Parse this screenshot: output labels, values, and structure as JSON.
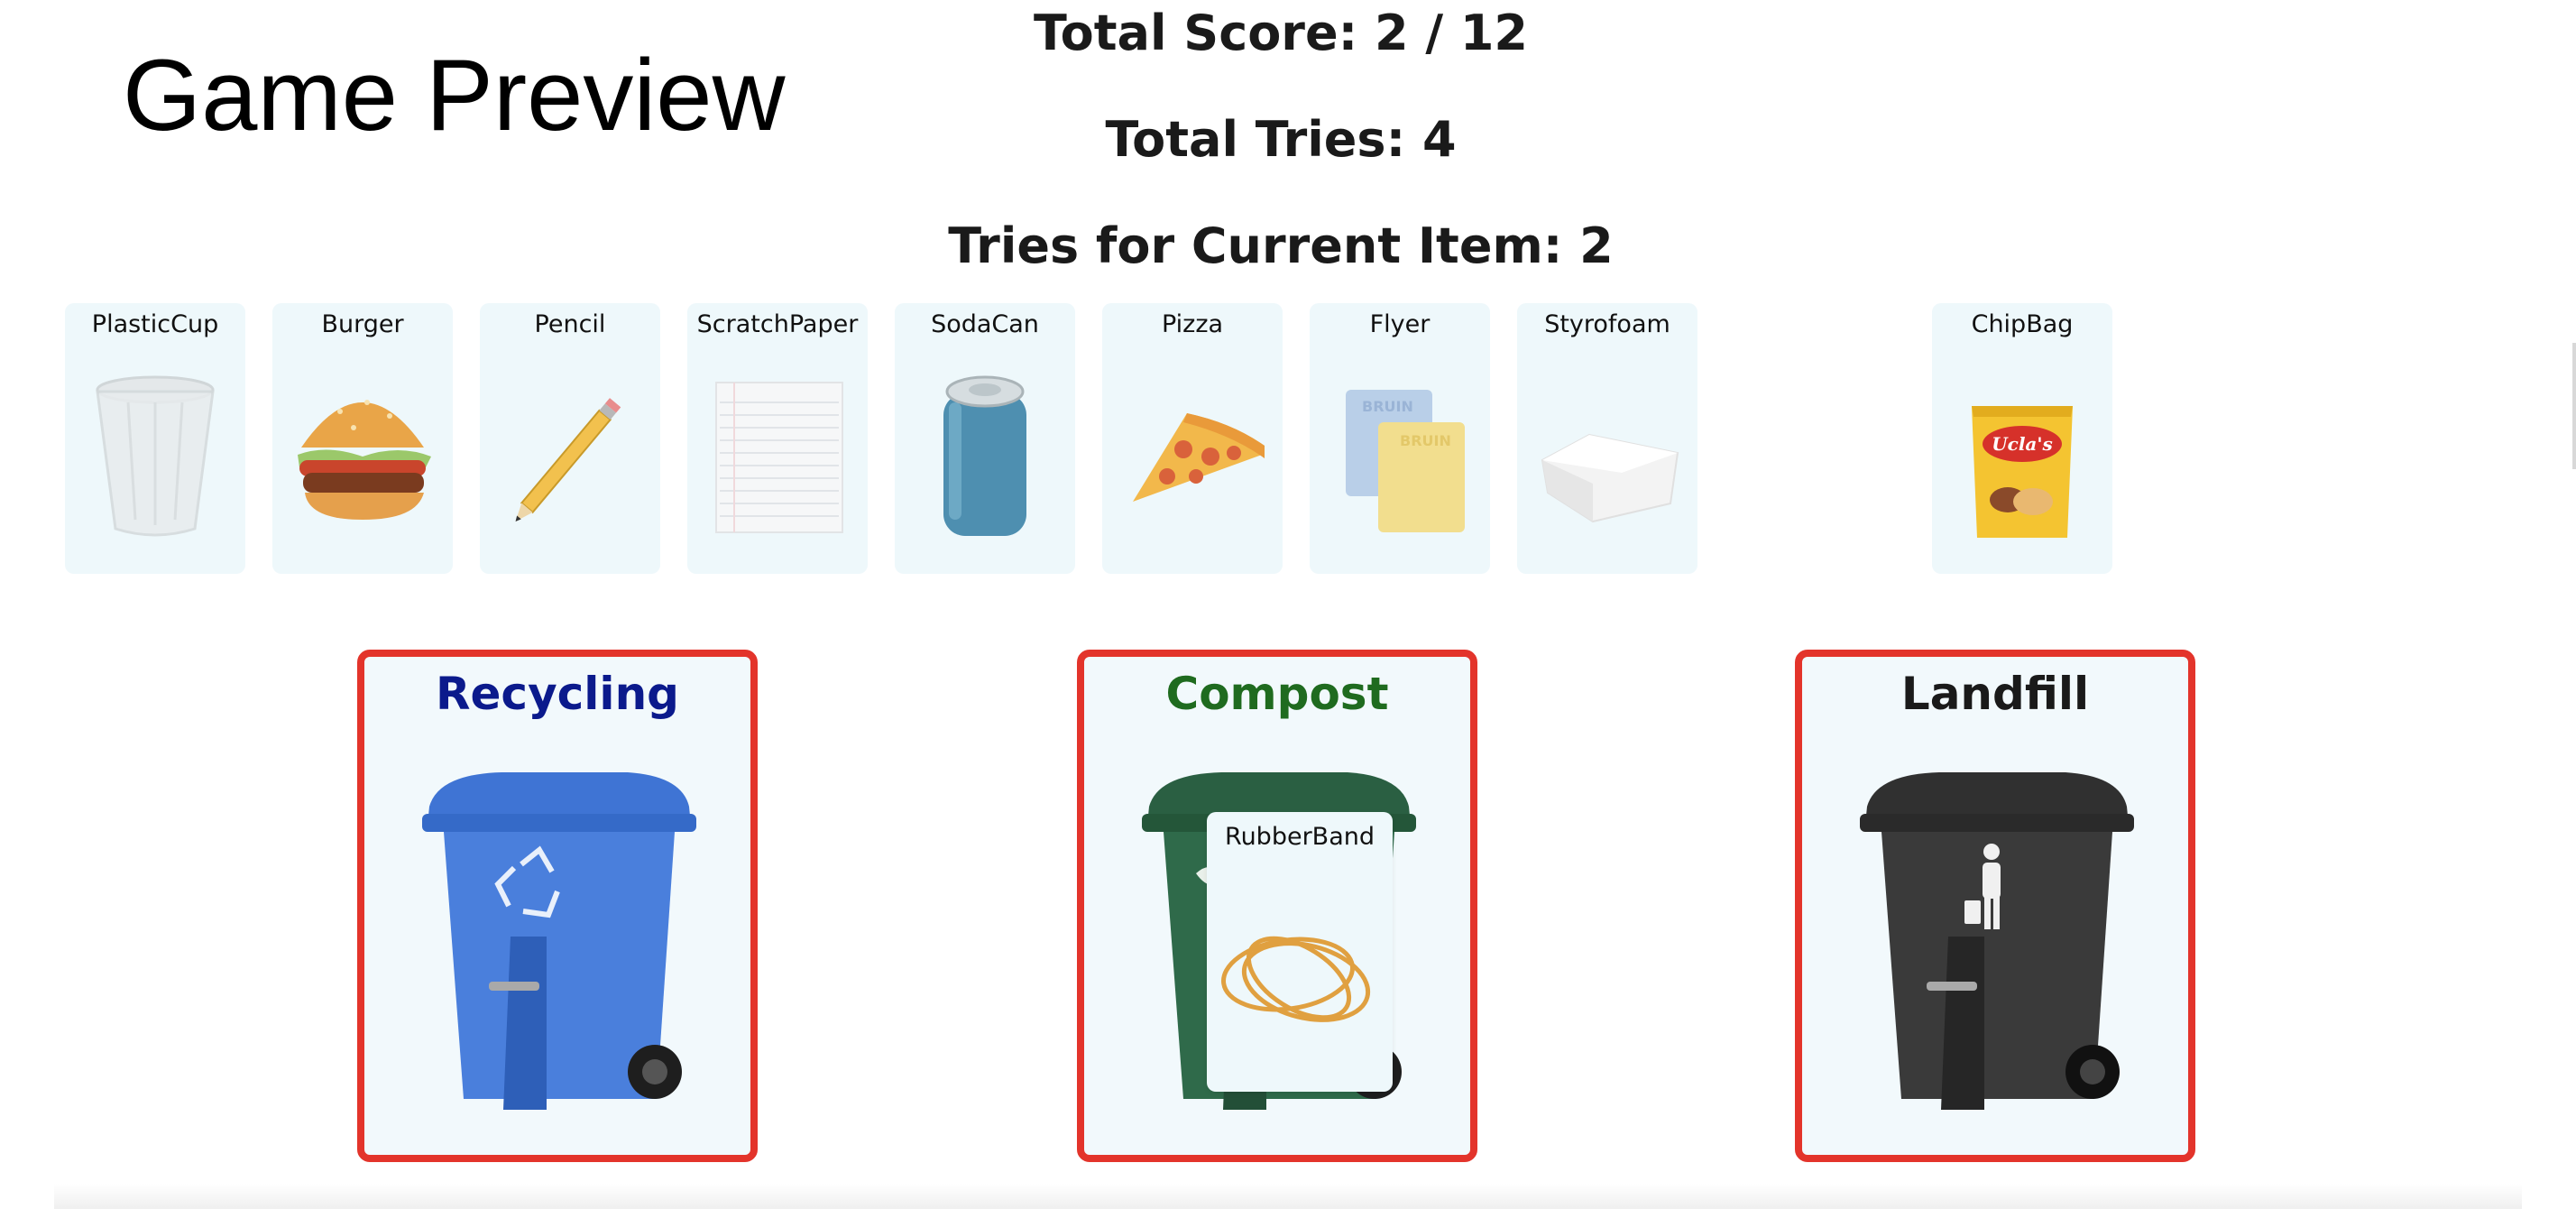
{
  "header": {
    "title": "Game Preview"
  },
  "stats": {
    "score_text": "Total Score: 2 / 12",
    "total_tries_text": "Total Tries: 4",
    "current_item_tries_text": "Tries for Current Item: 2"
  },
  "items": [
    {
      "label": "PlasticCup",
      "icon": "plastic-cup-icon"
    },
    {
      "label": "Burger",
      "icon": "burger-icon"
    },
    {
      "label": "Pencil",
      "icon": "pencil-icon"
    },
    {
      "label": "ScratchPaper",
      "icon": "scratch-paper-icon"
    },
    {
      "label": "SodaCan",
      "icon": "soda-can-icon"
    },
    {
      "label": "Pizza",
      "icon": "pizza-icon"
    },
    {
      "label": "Flyer",
      "icon": "flyer-icon"
    },
    {
      "label": "Styrofoam",
      "icon": "styrofoam-icon"
    },
    {
      "label": "ChipBag",
      "icon": "chip-bag-icon"
    }
  ],
  "chip_bag_brand": "Ucla's",
  "flyer_text": "BRUIN",
  "bins": [
    {
      "label": "Recycling",
      "color": "#0b1a8c",
      "bin_color": "#4a7fdc",
      "icon": "recycle-icon"
    },
    {
      "label": "Compost",
      "color": "#1f6b1f",
      "bin_color": "#2f6a4a",
      "icon": "leaf-icon"
    },
    {
      "label": "Landfill",
      "color": "#1a1a1a",
      "bin_color": "#3a3a3a",
      "icon": "trash-person-icon"
    }
  ],
  "dragged_item": {
    "label": "RubberBand",
    "icon": "rubber-band-icon"
  },
  "colors": {
    "card_bg": "#eef8fb",
    "bin_border": "#e3342b"
  }
}
